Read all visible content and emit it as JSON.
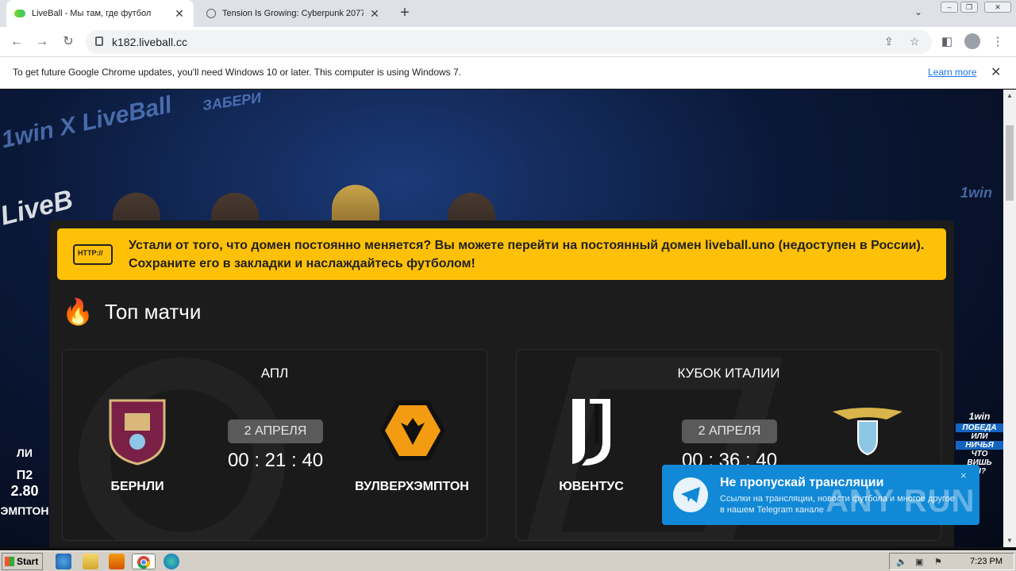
{
  "browser": {
    "tabs": [
      {
        "title": "LiveBall - Мы там, где футбол",
        "active": true
      },
      {
        "title": "Tension Is Growing: Cyberpunk 2077",
        "active": false
      }
    ],
    "url": "k182.liveball.cc",
    "infobar": {
      "message": "To get future Google Chrome updates, you'll need Windows 10 or later. This computer is using Windows 7.",
      "link": "Learn more"
    }
  },
  "page": {
    "banner_texts": [
      "1win X LiveBall",
      "ЗАБЕРИ",
      "LiveB",
      "1win"
    ],
    "notice": {
      "badge": "HTTP://",
      "text_before": "Устали от того, что домен постоянно меняется? Вы можете перейти на постоянный домен ",
      "link": "liveball.uno",
      "text_after": " (недоступен в России). Сохраните его в закладки и наслаждайтесь футболом!"
    },
    "section_title": "Топ матчи",
    "matches": [
      {
        "league": "АПЛ",
        "date": "2 АПРЕЛЯ",
        "timer": "00 : 21 : 40",
        "home": "БЕРНЛИ",
        "away": "ВУЛВЕРХЭМПТОН"
      },
      {
        "league": "КУБОК ИТАЛИИ",
        "date": "2 АПРЕЛЯ",
        "timer": "00 : 36 : 40",
        "home": "ЮВЕНТУС",
        "away": ""
      }
    ],
    "left_promo": {
      "line1": "ЛИ",
      "line2": "П2",
      "line3": "2.80",
      "line4": "ЭМПТОН"
    },
    "right_promo": {
      "brand": "1win",
      "line1": "ПОБЕДА",
      "line2": "ИЛИ",
      "line3": "НИЧЬЯ",
      "line4": "ЧТО",
      "line5": "ВИШЬ",
      "line6": "Ы?"
    },
    "telegram": {
      "title": "Не пропускай трансляции",
      "subtitle": "Ссылки на трансляции, новости футбола и многое другое в нашем Telegram канале",
      "close": "×"
    },
    "watermark": "ANY RUN"
  },
  "taskbar": {
    "start": "Start",
    "clock": "7:23 PM"
  },
  "colors": {
    "notice_bg": "#ffc107",
    "telegram_bg": "#1189d6",
    "card_bg": "#1a1a1a",
    "link": "#1a73e8"
  }
}
